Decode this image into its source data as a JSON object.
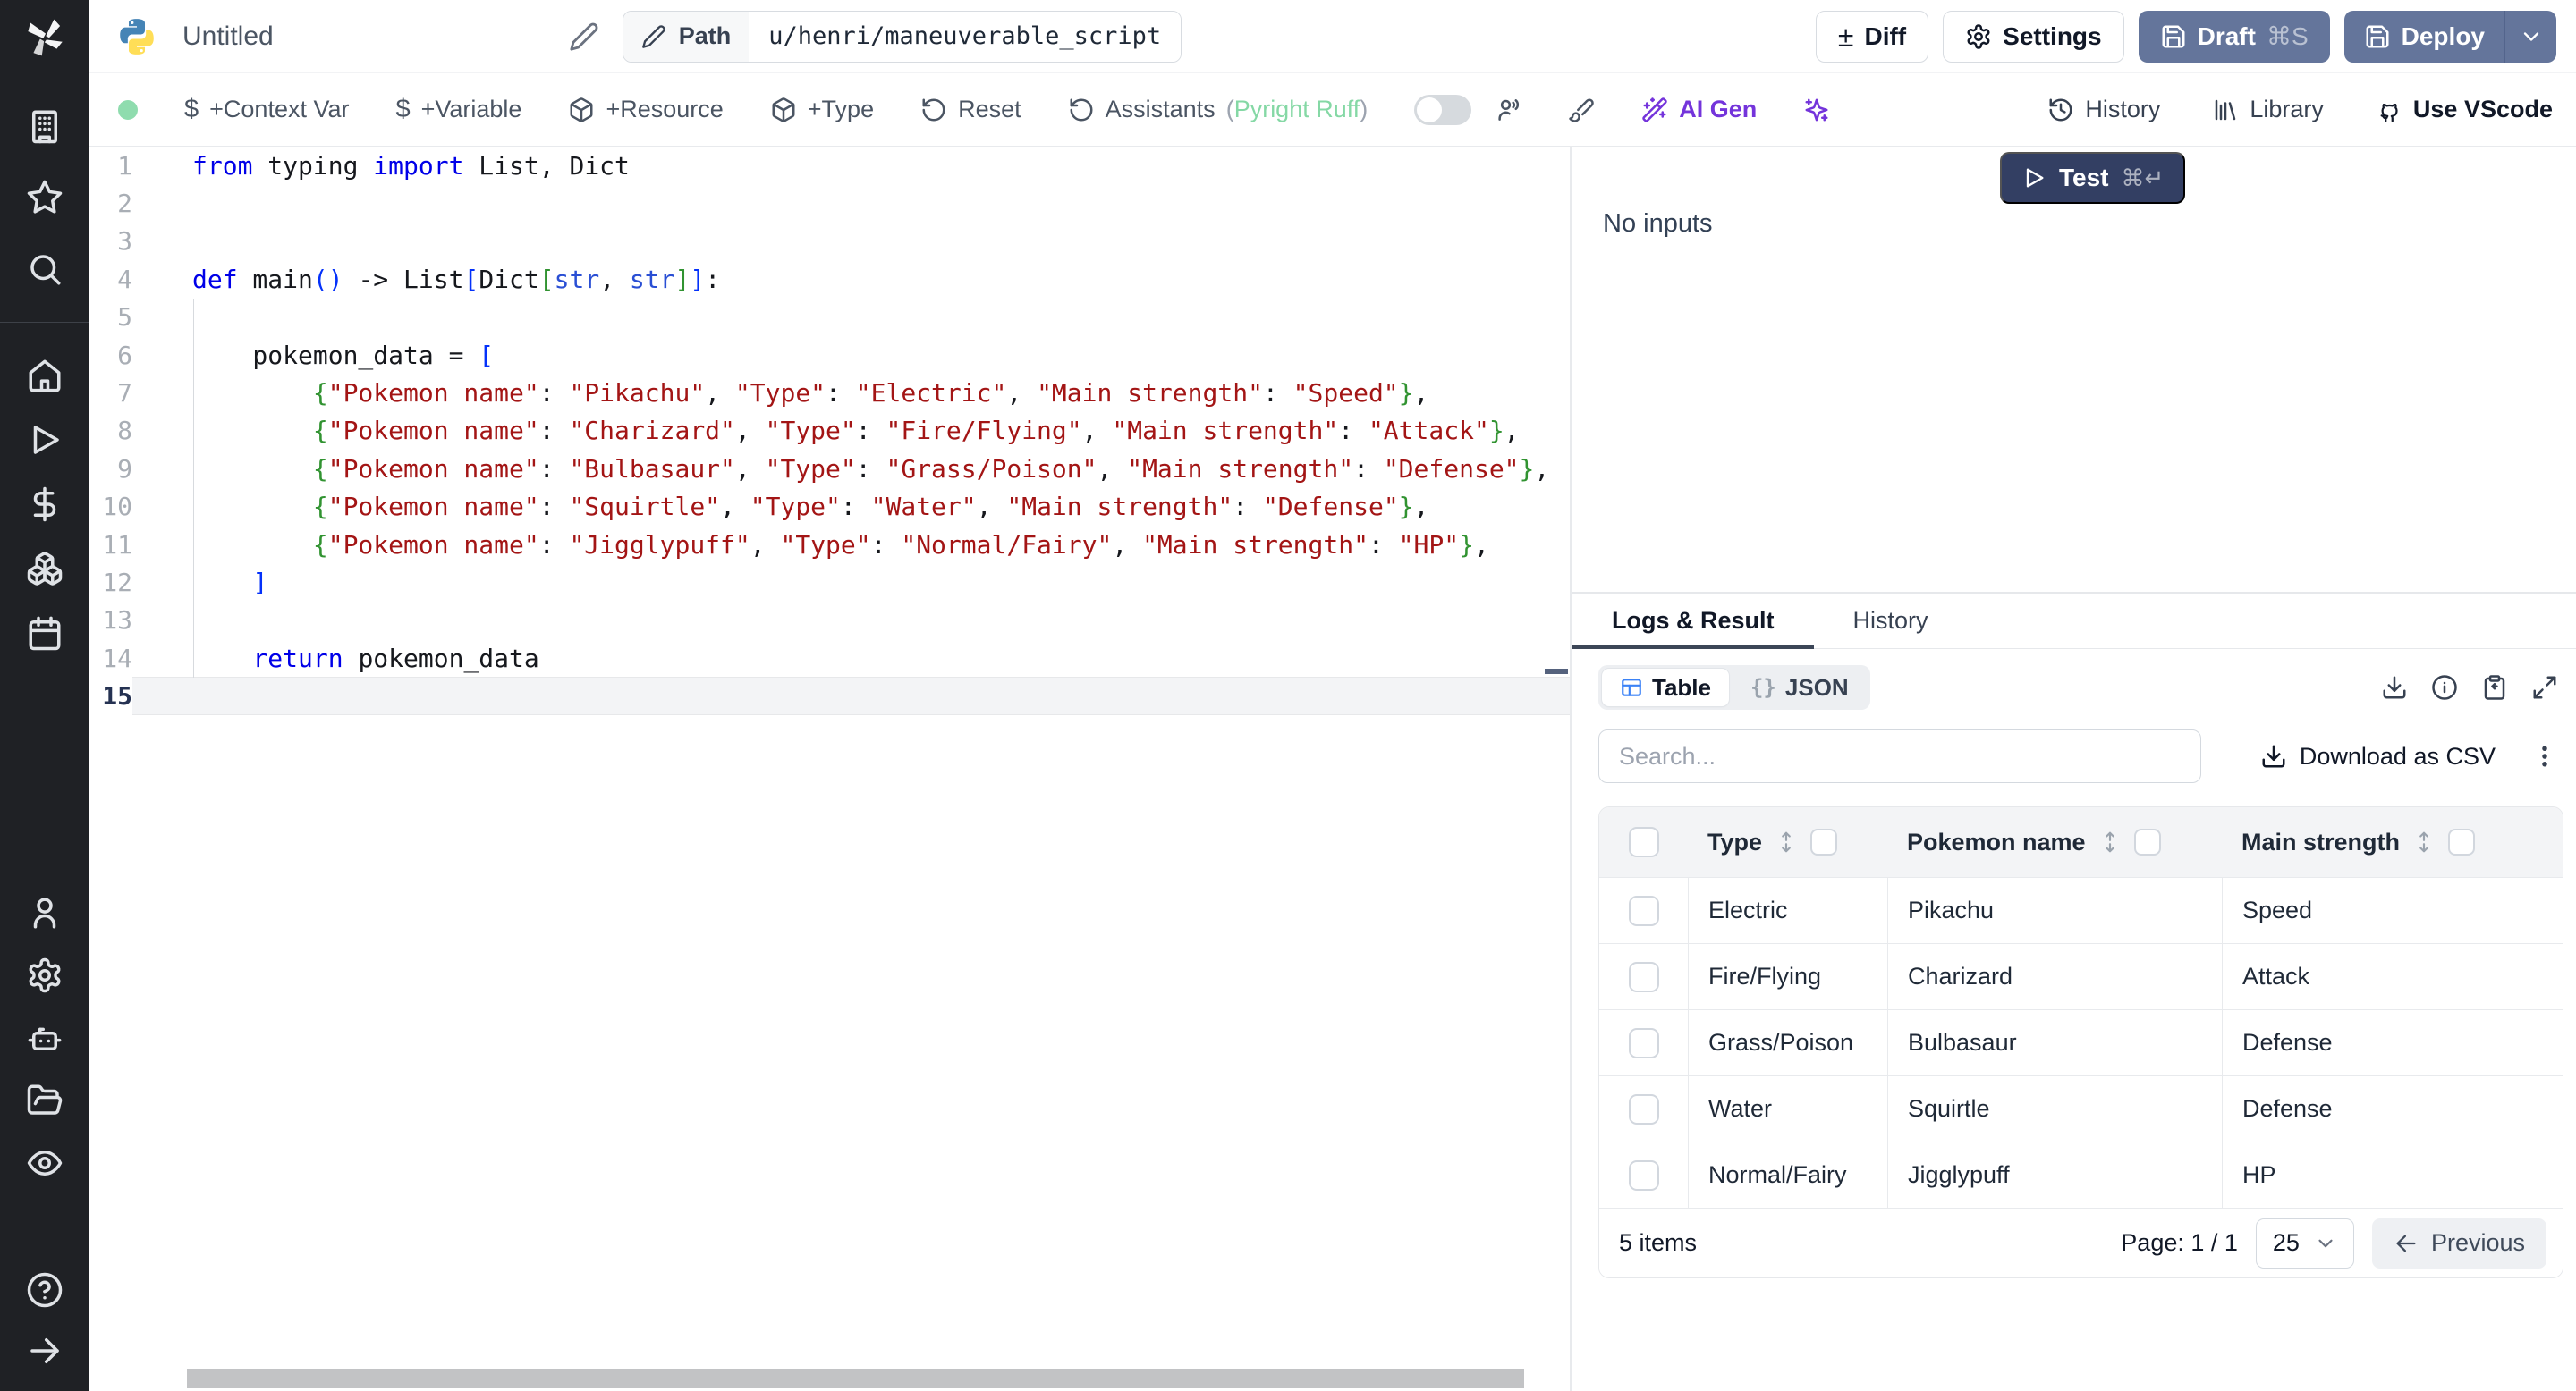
{
  "topbar": {
    "title": "Untitled",
    "path_label": "Path",
    "path_value": "u/henri/maneuverable_script",
    "diff_glyph": "±",
    "diff": "Diff",
    "settings": "Settings",
    "draft": "Draft",
    "draft_shortcut": "⌘S",
    "deploy": "Deploy"
  },
  "toolbar": {
    "context_var": "+Context Var",
    "variable": "+Variable",
    "resource": "+Resource",
    "type": "+Type",
    "reset": "Reset",
    "assistants": "Assistants",
    "paren_open": "(",
    "assistants_badge": "Pyright Ruff",
    "paren_close": ")",
    "dollar_glyph": "$",
    "ai_gen": "AI Gen",
    "history": "History",
    "library": "Library",
    "vscode": "Use VScode"
  },
  "editor": {
    "lines": [
      {
        "n": 1,
        "active": false,
        "tokens": [
          [
            "kw",
            "from"
          ],
          [
            "txt",
            " typing "
          ],
          [
            "kw",
            "import"
          ],
          [
            "txt",
            " List, Dict"
          ]
        ]
      },
      {
        "n": 2,
        "active": false,
        "tokens": []
      },
      {
        "n": 3,
        "active": false,
        "tokens": []
      },
      {
        "n": 4,
        "active": false,
        "tokens": [
          [
            "kw",
            "def"
          ],
          [
            "txt",
            " main"
          ],
          [
            "b1",
            "()"
          ],
          [
            "txt",
            " -> List"
          ],
          [
            "b1",
            "["
          ],
          [
            "txt",
            "Dict"
          ],
          [
            "b2",
            "["
          ],
          [
            "ty",
            "str"
          ],
          [
            "txt",
            ", "
          ],
          [
            "ty",
            "str"
          ],
          [
            "b2",
            "]"
          ],
          [
            "b1",
            "]"
          ],
          [
            "txt",
            ":"
          ]
        ]
      },
      {
        "n": 5,
        "active": false,
        "tokens": []
      },
      {
        "n": 6,
        "active": false,
        "tokens": [
          [
            "txt",
            "    pokemon_data = "
          ],
          [
            "b1",
            "["
          ]
        ]
      },
      {
        "n": 7,
        "active": false,
        "tokens": [
          [
            "txt",
            "        "
          ],
          [
            "b2",
            "{"
          ],
          [
            "str",
            "\"Pokemon name\""
          ],
          [
            "txt",
            ": "
          ],
          [
            "str",
            "\"Pikachu\""
          ],
          [
            "txt",
            ", "
          ],
          [
            "str",
            "\"Type\""
          ],
          [
            "txt",
            ": "
          ],
          [
            "str",
            "\"Electric\""
          ],
          [
            "txt",
            ", "
          ],
          [
            "str",
            "\"Main strength\""
          ],
          [
            "txt",
            ": "
          ],
          [
            "str",
            "\"Speed\""
          ],
          [
            "b2",
            "}"
          ],
          [
            "txt",
            ","
          ]
        ]
      },
      {
        "n": 8,
        "active": false,
        "tokens": [
          [
            "txt",
            "        "
          ],
          [
            "b2",
            "{"
          ],
          [
            "str",
            "\"Pokemon name\""
          ],
          [
            "txt",
            ": "
          ],
          [
            "str",
            "\"Charizard\""
          ],
          [
            "txt",
            ", "
          ],
          [
            "str",
            "\"Type\""
          ],
          [
            "txt",
            ": "
          ],
          [
            "str",
            "\"Fire/Flying\""
          ],
          [
            "txt",
            ", "
          ],
          [
            "str",
            "\"Main strength\""
          ],
          [
            "txt",
            ": "
          ],
          [
            "str",
            "\"Attack\""
          ],
          [
            "b2",
            "}"
          ],
          [
            "txt",
            ","
          ]
        ]
      },
      {
        "n": 9,
        "active": false,
        "tokens": [
          [
            "txt",
            "        "
          ],
          [
            "b2",
            "{"
          ],
          [
            "str",
            "\"Pokemon name\""
          ],
          [
            "txt",
            ": "
          ],
          [
            "str",
            "\"Bulbasaur\""
          ],
          [
            "txt",
            ", "
          ],
          [
            "str",
            "\"Type\""
          ],
          [
            "txt",
            ": "
          ],
          [
            "str",
            "\"Grass/Poison\""
          ],
          [
            "txt",
            ", "
          ],
          [
            "str",
            "\"Main strength\""
          ],
          [
            "txt",
            ": "
          ],
          [
            "str",
            "\"Defense\""
          ],
          [
            "b2",
            "}"
          ],
          [
            "txt",
            ","
          ]
        ]
      },
      {
        "n": 10,
        "active": false,
        "tokens": [
          [
            "txt",
            "        "
          ],
          [
            "b2",
            "{"
          ],
          [
            "str",
            "\"Pokemon name\""
          ],
          [
            "txt",
            ": "
          ],
          [
            "str",
            "\"Squirtle\""
          ],
          [
            "txt",
            ", "
          ],
          [
            "str",
            "\"Type\""
          ],
          [
            "txt",
            ": "
          ],
          [
            "str",
            "\"Water\""
          ],
          [
            "txt",
            ", "
          ],
          [
            "str",
            "\"Main strength\""
          ],
          [
            "txt",
            ": "
          ],
          [
            "str",
            "\"Defense\""
          ],
          [
            "b2",
            "}"
          ],
          [
            "txt",
            ","
          ]
        ]
      },
      {
        "n": 11,
        "active": false,
        "tokens": [
          [
            "txt",
            "        "
          ],
          [
            "b2",
            "{"
          ],
          [
            "str",
            "\"Pokemon name\""
          ],
          [
            "txt",
            ": "
          ],
          [
            "str",
            "\"Jigglypuff\""
          ],
          [
            "txt",
            ", "
          ],
          [
            "str",
            "\"Type\""
          ],
          [
            "txt",
            ": "
          ],
          [
            "str",
            "\"Normal/Fairy\""
          ],
          [
            "txt",
            ", "
          ],
          [
            "str",
            "\"Main strength\""
          ],
          [
            "txt",
            ": "
          ],
          [
            "str",
            "\"HP\""
          ],
          [
            "b2",
            "}"
          ],
          [
            "txt",
            ","
          ]
        ]
      },
      {
        "n": 12,
        "active": false,
        "tokens": [
          [
            "txt",
            "    "
          ],
          [
            "b1",
            "]"
          ]
        ]
      },
      {
        "n": 13,
        "active": false,
        "tokens": []
      },
      {
        "n": 14,
        "active": false,
        "tokens": [
          [
            "txt",
            "    "
          ],
          [
            "kw",
            "return"
          ],
          [
            "txt",
            " pokemon_data"
          ]
        ]
      },
      {
        "n": 15,
        "active": true,
        "tokens": []
      }
    ]
  },
  "run_panel": {
    "test": "Test",
    "test_shortcut": "⌘↵",
    "no_inputs": "No inputs"
  },
  "results": {
    "tab_logs": "Logs & Result",
    "tab_history": "History",
    "view_table": "Table",
    "view_json": "JSON",
    "json_glyph": "{}",
    "search_placeholder": "Search...",
    "download_csv": "Download as CSV"
  },
  "table": {
    "columns": [
      "Type",
      "Pokemon name",
      "Main strength"
    ],
    "rows": [
      [
        "Electric",
        "Pikachu",
        "Speed"
      ],
      [
        "Fire/Flying",
        "Charizard",
        "Attack"
      ],
      [
        "Grass/Poison",
        "Bulbasaur",
        "Defense"
      ],
      [
        "Water",
        "Squirtle",
        "Defense"
      ],
      [
        "Normal/Fairy",
        "Jigglypuff",
        "HP"
      ]
    ],
    "footer": {
      "items_text": "5 items",
      "page_text": "Page: 1 / 1",
      "page_size": "25",
      "previous": "Previous"
    }
  },
  "colors": {
    "accent_slate_button": "#64759b",
    "test_button": "#333f63",
    "ai_purple": "#7434db",
    "assistant_green": "#85d8a5",
    "status_green": "#8fdcae",
    "table_icon_blue": "#3b82f6"
  }
}
